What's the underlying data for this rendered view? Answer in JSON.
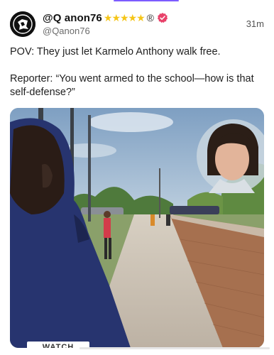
{
  "post": {
    "display_name": "@Q anon76",
    "rating_stars": "★★★★★",
    "registered_mark": "®",
    "handle": "@Qanon76",
    "timestamp": "31m",
    "text_line_1": "POV: They just let Karmelo Anthony walk free.",
    "text_line_2": "Reporter: “You went armed to the school—how is that self-defense?”",
    "media": {
      "badge": "WATCH"
    }
  },
  "icons": {
    "avatar": "profile-avatar",
    "verified": "verified-badge-icon"
  },
  "colors": {
    "verified_badge": "#e8426a",
    "star": "#f5c518",
    "accent_strip": "#7c5cff"
  }
}
